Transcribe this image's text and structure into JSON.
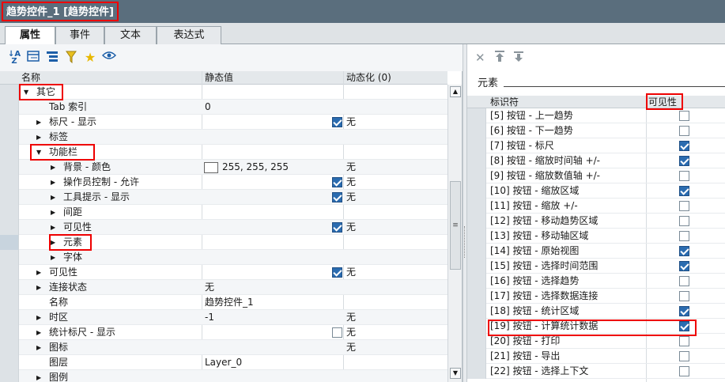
{
  "window": {
    "title": "趋势控件_1 [趋势控件]"
  },
  "tabs": [
    {
      "label": "属性",
      "active": true
    },
    {
      "label": "事件",
      "active": false
    },
    {
      "label": "文本",
      "active": false
    },
    {
      "label": "表达式",
      "active": false
    }
  ],
  "toolbar": {
    "sort_icon": "sort-az-icon",
    "icons": [
      "sort-az-icon",
      "list-view-icon",
      "tree-view-icon",
      "filter-icon",
      "favorite-star-icon",
      "view-eye-icon"
    ]
  },
  "grid": {
    "headers": {
      "name": "名称",
      "static": "静态值",
      "dynamic": "动态化 (0)"
    },
    "rows": [
      {
        "name": "其它",
        "level": 0,
        "arrow": "down",
        "stat": "",
        "dyn": ""
      },
      {
        "name": "Tab 索引",
        "level": 1,
        "arrow": "",
        "stat": "0",
        "dyn": ""
      },
      {
        "name": "标尺 - 显示",
        "level": 1,
        "arrow": "right",
        "checkbox": true,
        "dyn": "无"
      },
      {
        "name": "标签",
        "level": 1,
        "arrow": "right",
        "stat": "",
        "dyn": ""
      },
      {
        "name": "功能栏",
        "level": 1,
        "arrow": "down",
        "stat": "",
        "dyn": ""
      },
      {
        "name": "背景 - 颜色",
        "level": 2,
        "arrow": "right",
        "stat": "255, 255, 255",
        "swatch": true,
        "dyn": "无"
      },
      {
        "name": "操作员控制 - 允许",
        "level": 2,
        "arrow": "right",
        "checkbox": true,
        "dyn": "无"
      },
      {
        "name": "工具提示 - 显示",
        "level": 2,
        "arrow": "right",
        "checkbox": true,
        "dyn": "无"
      },
      {
        "name": "间距",
        "level": 2,
        "arrow": "right",
        "stat": "",
        "dyn": ""
      },
      {
        "name": "可见性",
        "level": 2,
        "arrow": "right",
        "checkbox": true,
        "dyn": "无"
      },
      {
        "name": "元素",
        "level": 2,
        "arrow": "right",
        "stat": "",
        "dyn": "",
        "selected": true
      },
      {
        "name": "字体",
        "level": 2,
        "arrow": "right",
        "stat": "",
        "dyn": ""
      },
      {
        "name": "可见性",
        "level": 1,
        "arrow": "right",
        "checkbox": true,
        "dyn": "无"
      },
      {
        "name": "连接状态",
        "level": 1,
        "arrow": "right",
        "stat": "无",
        "dyn": ""
      },
      {
        "name": "名称",
        "level": 1,
        "arrow": "",
        "stat": "趋势控件_1",
        "dyn": ""
      },
      {
        "name": "时区",
        "level": 1,
        "arrow": "right",
        "stat": "-1",
        "dyn": "无"
      },
      {
        "name": "统计标尺 - 显示",
        "level": 1,
        "arrow": "right",
        "checkbox": false,
        "dyn": "无"
      },
      {
        "name": "图标",
        "level": 1,
        "arrow": "right",
        "stat": "",
        "dyn": "无"
      },
      {
        "name": "图层",
        "level": 1,
        "arrow": "",
        "stat": "Layer_0",
        "dyn": ""
      },
      {
        "name": "图例",
        "level": 1,
        "arrow": "right",
        "stat": "",
        "dyn": ""
      }
    ]
  },
  "right_panel": {
    "tools": [
      "delete-x-icon",
      "move-up-icon",
      "move-down-icon"
    ],
    "element_label": "元素",
    "headers": {
      "id": "标识符",
      "visible": "可见性"
    },
    "items": [
      {
        "label": "[5] 按钮 - 上一趋势",
        "visible": false
      },
      {
        "label": "[6] 按钮 - 下一趋势",
        "visible": false
      },
      {
        "label": "[7] 按钮 - 标尺",
        "visible": true
      },
      {
        "label": "[8] 按钮 - 缩放时间轴 +/-",
        "visible": true
      },
      {
        "label": "[9] 按钮 - 缩放数值轴 +/-",
        "visible": false
      },
      {
        "label": "[10] 按钮 - 缩放区域",
        "visible": true
      },
      {
        "label": "[11] 按钮 - 缩放 +/-",
        "visible": false
      },
      {
        "label": "[12] 按钮 - 移动趋势区域",
        "visible": false
      },
      {
        "label": "[13] 按钮 - 移动轴区域",
        "visible": false
      },
      {
        "label": "[14] 按钮 - 原始视图",
        "visible": true
      },
      {
        "label": "[15] 按钮 - 选择时间范围",
        "visible": true
      },
      {
        "label": "[16] 按钮 - 选择趋势",
        "visible": false
      },
      {
        "label": "[17] 按钮 - 选择数据连接",
        "visible": false
      },
      {
        "label": "[18] 按钮 - 统计区域",
        "visible": true
      },
      {
        "label": "[19] 按钮 - 计算统计数据",
        "visible": true
      },
      {
        "label": "[20] 按钮 - 打印",
        "visible": false
      },
      {
        "label": "[21] 按钮 - 导出",
        "visible": false
      },
      {
        "label": "[22] 按钮 - 选择上下文",
        "visible": false
      }
    ]
  }
}
